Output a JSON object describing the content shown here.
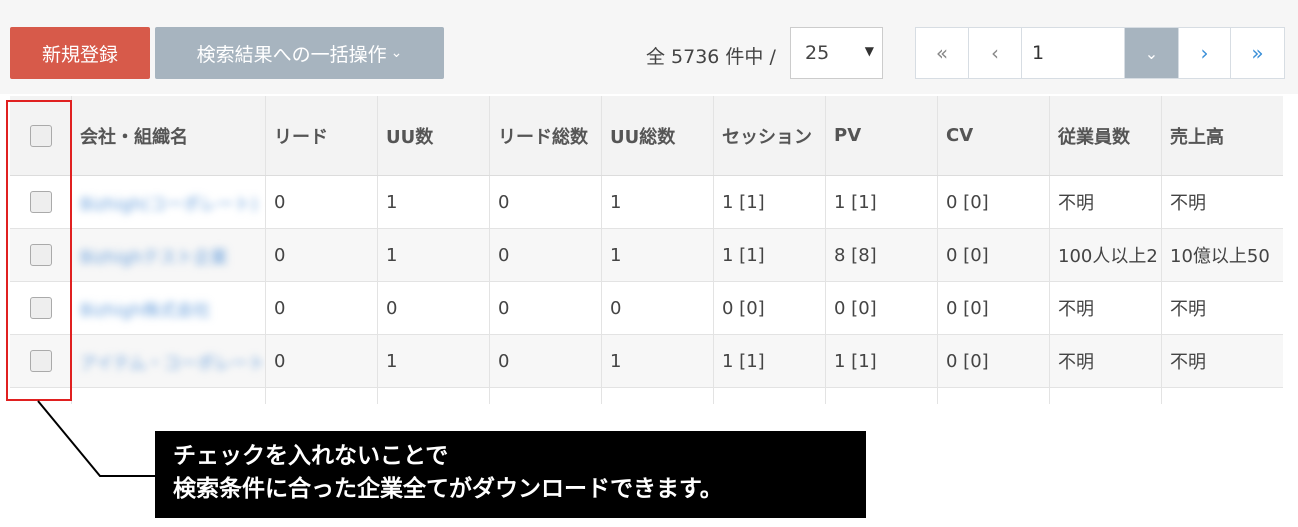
{
  "toolbar": {
    "new_label": "新規登録",
    "bulk_label": "検索結果への一括操作",
    "bulk_chevron": "⌄",
    "count_text": "全 5736 件中 /",
    "per_page": "25",
    "per_page_caret": "▼"
  },
  "pager": {
    "first": "«",
    "prev": "‹",
    "page": "1",
    "dropdown": "⌄",
    "next": "›",
    "last": "»"
  },
  "table": {
    "headers": [
      "会社・組織名",
      "リード",
      "UU数",
      "リード総数",
      "UU総数",
      "セッション",
      "PV",
      "CV",
      "従業員数",
      "売上高"
    ],
    "rows": [
      {
        "name": "Bizhigh(コーポレート)",
        "lead": "0",
        "uu": "1",
        "lead_total": "0",
        "uu_total": "1",
        "session": "1 [1]",
        "pv": "1 [1]",
        "cv": "0 [0]",
        "employees": "不明",
        "revenue": "不明"
      },
      {
        "name": "Bizhighテスト企業",
        "lead": "0",
        "uu": "1",
        "lead_total": "0",
        "uu_total": "1",
        "session": "1 [1]",
        "pv": "8 [8]",
        "cv": "0 [0]",
        "employees": "100人以上2",
        "revenue": "10億以上50"
      },
      {
        "name": "Bizhigh株式会社",
        "lead": "0",
        "uu": "0",
        "lead_total": "0",
        "uu_total": "0",
        "session": "0 [0]",
        "pv": "0 [0]",
        "cv": "0 [0]",
        "employees": "不明",
        "revenue": "不明"
      },
      {
        "name": "アイテム・コーポレート",
        "lead": "0",
        "uu": "1",
        "lead_total": "0",
        "uu_total": "1",
        "session": "1 [1]",
        "pv": "1 [1]",
        "cv": "0 [0]",
        "employees": "不明",
        "revenue": "不明"
      }
    ]
  },
  "callout": {
    "line1": "チェックを入れないことで",
    "line2": "検索条件に合った企業全てがダウンロードできます。"
  },
  "colors": {
    "new_button": "#d75a4a",
    "bulk_button": "#a7b4bf",
    "highlight": "#e02020",
    "pager_active": "#3a8fd8"
  }
}
